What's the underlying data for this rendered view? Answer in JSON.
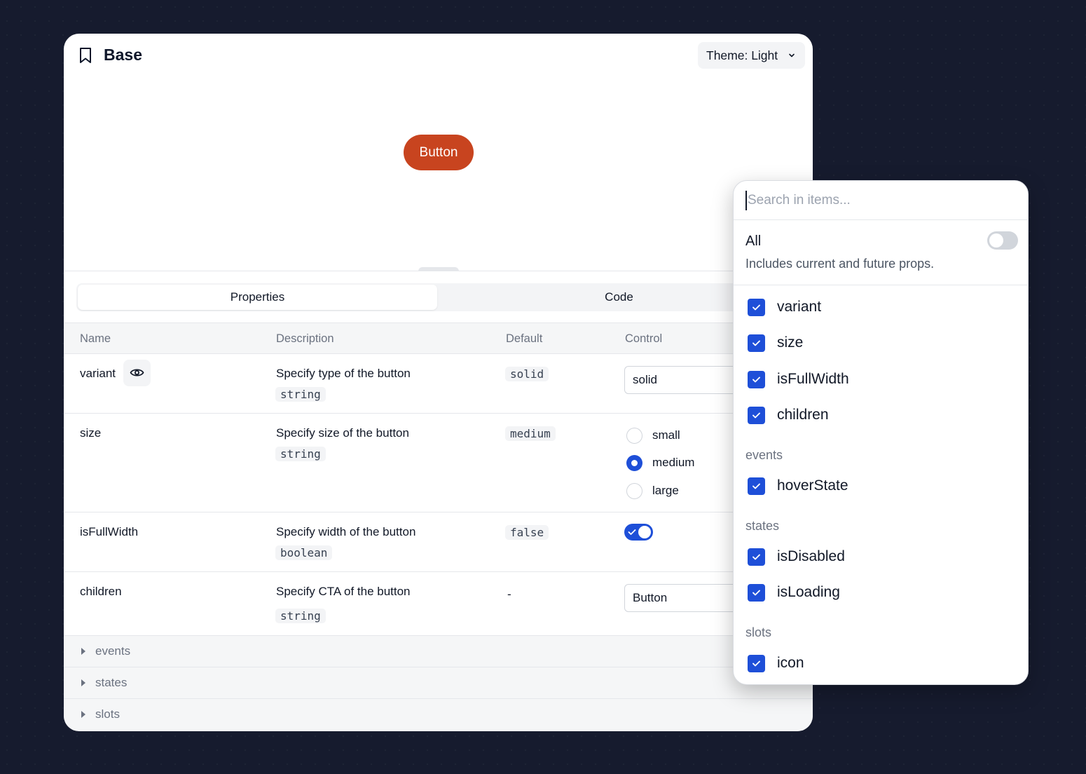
{
  "window": {
    "title": "Base",
    "theme_label": "Theme: Light"
  },
  "preview": {
    "button_label": "Button",
    "button_color": "#c8441f"
  },
  "tabs": [
    {
      "label": "Properties",
      "active": true
    },
    {
      "label": "Code",
      "active": false
    }
  ],
  "table": {
    "headers": [
      "Name",
      "Description",
      "Default",
      "Control"
    ],
    "rows": [
      {
        "name": "variant",
        "description": "Specify type of the button",
        "type": "string",
        "default": "solid",
        "control": "solid"
      },
      {
        "name": "size",
        "description": "Specify size of the button",
        "type": "string",
        "default": "medium",
        "control_options": [
          "small",
          "medium",
          "large"
        ],
        "control_selected": "medium"
      },
      {
        "name": "isFullWidth",
        "description": "Specify width of the button",
        "type": "boolean",
        "default": "false",
        "control_checked": true
      },
      {
        "name": "children",
        "description": "Specify CTA of the button",
        "type": "string",
        "default": "-",
        "control": "Button"
      }
    ],
    "groups": [
      "events",
      "states",
      "slots"
    ]
  },
  "panel": {
    "search_placeholder": "Search in items...",
    "all_label": "All",
    "all_description": "Includes current and future props.",
    "all_enabled": false,
    "props": [
      "variant",
      "size",
      "isFullWidth",
      "children"
    ],
    "sections": [
      {
        "label": "events",
        "items": [
          "hoverState"
        ]
      },
      {
        "label": "states",
        "items": [
          "isDisabled",
          "isLoading"
        ]
      },
      {
        "label": "slots",
        "items": [
          "icon"
        ]
      }
    ]
  },
  "colors": {
    "background": "#161b2e",
    "accent": "#1e4fd8",
    "brand_button": "#c8441f"
  },
  "icons": {
    "title": "bookmark-icon",
    "dropdown": "chevron-down-icon",
    "visibility": "eye-icon",
    "checkbox": "check-icon",
    "group": "caret-right-icon"
  }
}
